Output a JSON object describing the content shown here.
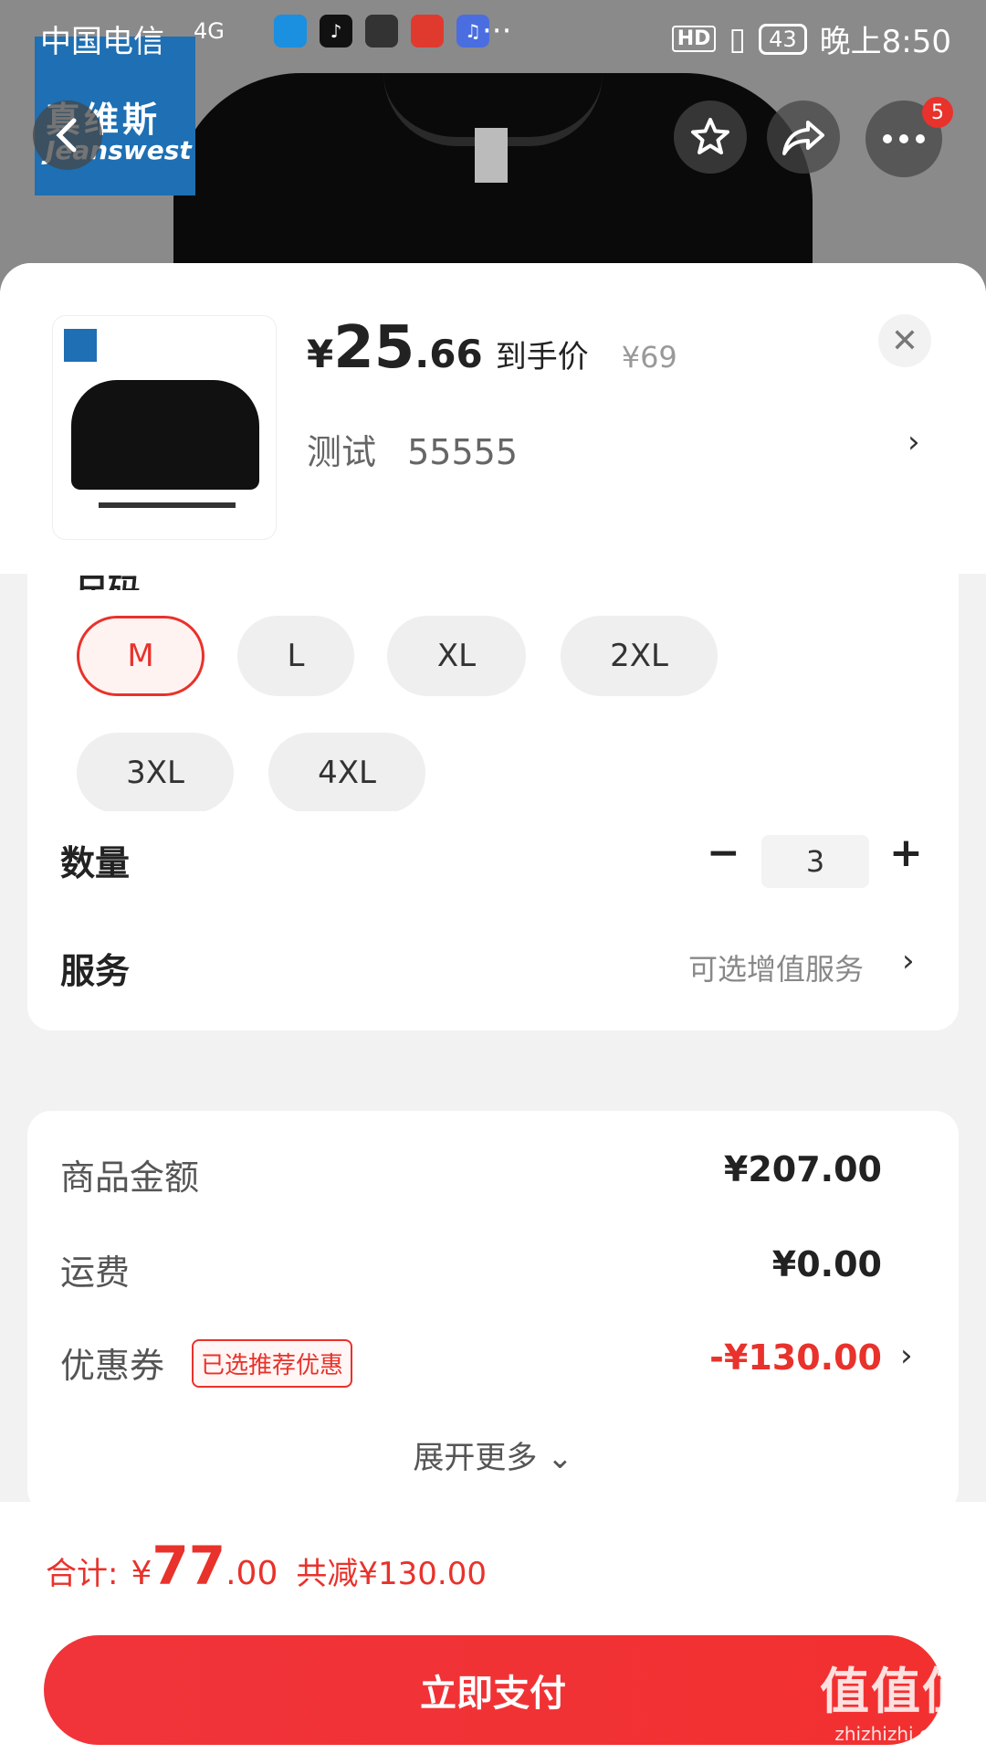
{
  "status_bar": {
    "carrier": "中国电信",
    "network": "4G",
    "apps": [
      "浏览器",
      "抖音",
      "华为",
      "值",
      "音乐"
    ],
    "more": "···",
    "hd": "HD",
    "battery": "43",
    "time": "晚上8:50"
  },
  "hero": {
    "brand_cn": "真维斯",
    "brand_en": "Jeanswest",
    "more_badge_count": "5"
  },
  "product": {
    "price_symbol": "¥",
    "price_int": "25",
    "price_dec": ".66",
    "price_label": "到手价",
    "original_price": "¥69",
    "variant_name": "测试",
    "variant_value": "55555"
  },
  "size": {
    "title": "尺码",
    "options": [
      "M",
      "L",
      "XL",
      "2XL",
      "3XL",
      "4XL"
    ],
    "selected": "M"
  },
  "quantity": {
    "label": "数量",
    "minus": "−",
    "value": "3",
    "plus": "+"
  },
  "service": {
    "label": "服务",
    "hint": "可选增值服务"
  },
  "summary": {
    "goods_label": "商品金额",
    "goods_value": "¥207.00",
    "shipping_label": "运费",
    "shipping_value": "¥0.00",
    "coupon_label": "优惠券",
    "coupon_tag": "已选推荐优惠",
    "coupon_value": "-¥130.00",
    "expand_label": "展开更多"
  },
  "footer": {
    "total_label": "合计:",
    "total_symbol": "¥",
    "total_int": "77",
    "total_dec": ".00",
    "total_saved": "共减¥130.00",
    "pay_label": "立即支付"
  },
  "watermark": {
    "line1": "值值值",
    "line2": "zhizhizhi.com"
  },
  "colors": {
    "accent": "#e8322b",
    "chip_bg": "#efefef"
  }
}
